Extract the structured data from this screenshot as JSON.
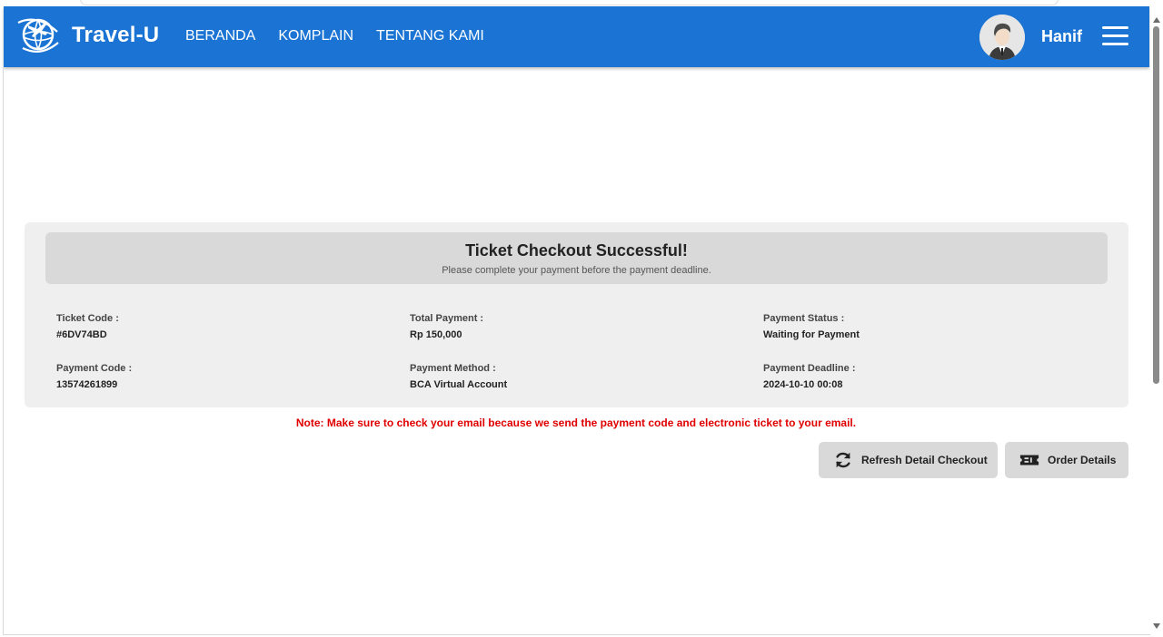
{
  "navbar": {
    "brand": "Travel-U",
    "links": [
      "BERANDA",
      "KOMPLAIN",
      "TENTANG KAMI"
    ],
    "user_name": "Hanif",
    "color": "#1b74d3"
  },
  "checkout": {
    "title": "Ticket Checkout Successful!",
    "subtitle": "Please complete your payment before the payment deadline.",
    "fields": [
      {
        "label": "Ticket Code :",
        "value": "#6DV74BD"
      },
      {
        "label": "Total Payment :",
        "value": "Rp 150,000"
      },
      {
        "label": "Payment Status :",
        "value": "Waiting for Payment"
      },
      {
        "label": "Payment Code :",
        "value": "13574261899"
      },
      {
        "label": "Payment Method :",
        "value": "BCA Virtual Account"
      },
      {
        "label": "Payment Deadline :",
        "value": "2024-10-10 00:08"
      }
    ],
    "note": "Note: Make sure to check your email because we send the payment code and electronic ticket to your email.",
    "note_color": "#e00000"
  },
  "actions": {
    "refresh_label": "Refresh Detail Checkout",
    "order_label": "Order Details"
  },
  "icons": {
    "logo": "globe-plane-icon",
    "avatar": "user-avatar",
    "menu": "hamburger-menu-icon",
    "refresh": "refresh-icon",
    "ticket": "ticket-icon"
  }
}
